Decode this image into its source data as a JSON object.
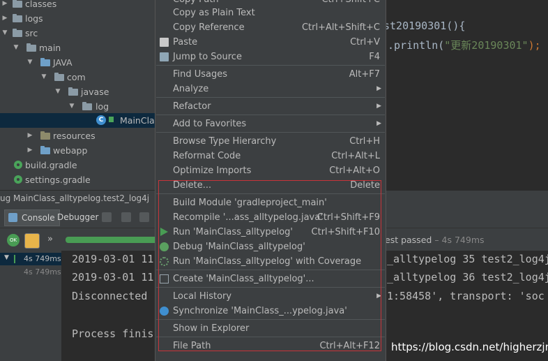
{
  "tree": {
    "items": [
      {
        "label": "classes"
      },
      {
        "label": "logs"
      },
      {
        "label": "src"
      },
      {
        "label": "main"
      },
      {
        "label": "JAVA"
      },
      {
        "label": "com"
      },
      {
        "label": "javase"
      },
      {
        "label": "log"
      },
      {
        "label": "MainClas"
      },
      {
        "label": "resources"
      },
      {
        "label": "webapp"
      },
      {
        "label": "build.gradle"
      },
      {
        "label": "settings.gradle"
      }
    ]
  },
  "editor": {
    "line1": "st20190301(){",
    "line2_prefix": ".println(",
    "line2_string": "\"更新20190301\"",
    "line2_suffix": ");"
  },
  "run": {
    "config_title": "ug  MainClass_alltypelog.test2_log4j",
    "tab_console": "Console",
    "tab_debugger": "Debugger",
    "test_status": "est passed",
    "test_duration": "– 4s 749ms",
    "tree_time1": "4s 749ms",
    "tree_time2": "4s 749ms",
    "console_lines": [
      "2019-03-01 11",
      "2019-03-01 11",
      "Disconnected",
      "",
      "Process finis"
    ],
    "console_right": [
      "_alltypelog 35 test2_log4j",
      "_alltypelog 36 test2_log4j",
      "1:58458', transport: 'soc"
    ]
  },
  "menu": {
    "items": [
      {
        "label": "Copy Path",
        "shortcut": "Ctrl+Shift+C"
      },
      {
        "label": "Copy as Plain Text",
        "shortcut": ""
      },
      {
        "label": "Copy Reference",
        "shortcut": "Ctrl+Alt+Shift+C"
      },
      {
        "label": "Paste",
        "shortcut": "Ctrl+V"
      },
      {
        "label": "Jump to Source",
        "shortcut": "F4"
      },
      {
        "label": "Find Usages",
        "shortcut": "Alt+F7"
      },
      {
        "label": "Analyze",
        "shortcut": ""
      },
      {
        "label": "Refactor",
        "shortcut": ""
      },
      {
        "label": "Add to Favorites",
        "shortcut": ""
      },
      {
        "label": "Browse Type Hierarchy",
        "shortcut": "Ctrl+H"
      },
      {
        "label": "Reformat Code",
        "shortcut": "Ctrl+Alt+L"
      },
      {
        "label": "Optimize Imports",
        "shortcut": "Ctrl+Alt+O"
      },
      {
        "label": "Delete...",
        "shortcut": "Delete"
      },
      {
        "label": "Build Module 'gradleproject_main'",
        "shortcut": ""
      },
      {
        "label": "Recompile '...ass_alltypelog.java'",
        "shortcut": "Ctrl+Shift+F9"
      },
      {
        "label": "Run 'MainClass_alltypelog'",
        "shortcut": "Ctrl+Shift+F10"
      },
      {
        "label": "Debug 'MainClass_alltypelog'",
        "shortcut": ""
      },
      {
        "label": "Run 'MainClass_alltypelog' with Coverage",
        "shortcut": ""
      },
      {
        "label": "Create 'MainClass_alltypelog'...",
        "shortcut": ""
      },
      {
        "label": "Local History",
        "shortcut": ""
      },
      {
        "label": "Synchronize 'MainClass_...ypelog.java'",
        "shortcut": ""
      },
      {
        "label": "Show in Explorer",
        "shortcut": ""
      },
      {
        "label": "File Path",
        "shortcut": "Ctrl+Alt+F12"
      }
    ]
  },
  "watermark": "https://blog.csdn.net/higherzjm",
  "colors": {
    "background": "#2b2b2b",
    "panel": "#3c3f41",
    "highlight_box": "#c8343a",
    "string": "#6a8759",
    "progress_green": "#499c54"
  }
}
